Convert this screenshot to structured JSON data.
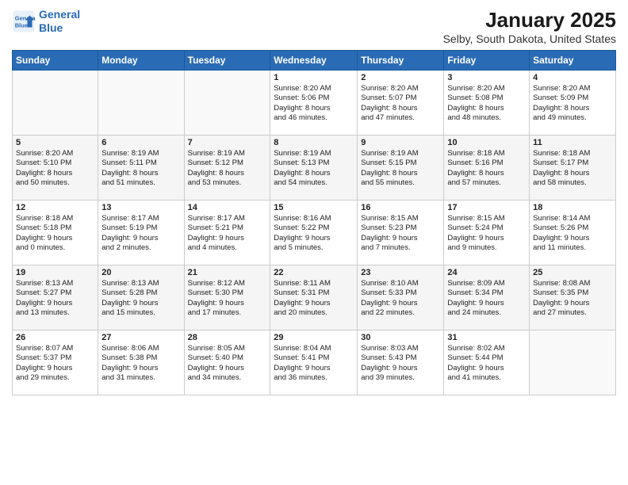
{
  "header": {
    "logo_line1": "General",
    "logo_line2": "Blue",
    "title": "January 2025",
    "subtitle": "Selby, South Dakota, United States"
  },
  "days_of_week": [
    "Sunday",
    "Monday",
    "Tuesday",
    "Wednesday",
    "Thursday",
    "Friday",
    "Saturday"
  ],
  "weeks": [
    [
      {
        "day": "",
        "info": ""
      },
      {
        "day": "",
        "info": ""
      },
      {
        "day": "",
        "info": ""
      },
      {
        "day": "1",
        "info": "Sunrise: 8:20 AM\nSunset: 5:06 PM\nDaylight: 8 hours\nand 46 minutes."
      },
      {
        "day": "2",
        "info": "Sunrise: 8:20 AM\nSunset: 5:07 PM\nDaylight: 8 hours\nand 47 minutes."
      },
      {
        "day": "3",
        "info": "Sunrise: 8:20 AM\nSunset: 5:08 PM\nDaylight: 8 hours\nand 48 minutes."
      },
      {
        "day": "4",
        "info": "Sunrise: 8:20 AM\nSunset: 5:09 PM\nDaylight: 8 hours\nand 49 minutes."
      }
    ],
    [
      {
        "day": "5",
        "info": "Sunrise: 8:20 AM\nSunset: 5:10 PM\nDaylight: 8 hours\nand 50 minutes."
      },
      {
        "day": "6",
        "info": "Sunrise: 8:19 AM\nSunset: 5:11 PM\nDaylight: 8 hours\nand 51 minutes."
      },
      {
        "day": "7",
        "info": "Sunrise: 8:19 AM\nSunset: 5:12 PM\nDaylight: 8 hours\nand 53 minutes."
      },
      {
        "day": "8",
        "info": "Sunrise: 8:19 AM\nSunset: 5:13 PM\nDaylight: 8 hours\nand 54 minutes."
      },
      {
        "day": "9",
        "info": "Sunrise: 8:19 AM\nSunset: 5:15 PM\nDaylight: 8 hours\nand 55 minutes."
      },
      {
        "day": "10",
        "info": "Sunrise: 8:18 AM\nSunset: 5:16 PM\nDaylight: 8 hours\nand 57 minutes."
      },
      {
        "day": "11",
        "info": "Sunrise: 8:18 AM\nSunset: 5:17 PM\nDaylight: 8 hours\nand 58 minutes."
      }
    ],
    [
      {
        "day": "12",
        "info": "Sunrise: 8:18 AM\nSunset: 5:18 PM\nDaylight: 9 hours\nand 0 minutes."
      },
      {
        "day": "13",
        "info": "Sunrise: 8:17 AM\nSunset: 5:19 PM\nDaylight: 9 hours\nand 2 minutes."
      },
      {
        "day": "14",
        "info": "Sunrise: 8:17 AM\nSunset: 5:21 PM\nDaylight: 9 hours\nand 4 minutes."
      },
      {
        "day": "15",
        "info": "Sunrise: 8:16 AM\nSunset: 5:22 PM\nDaylight: 9 hours\nand 5 minutes."
      },
      {
        "day": "16",
        "info": "Sunrise: 8:15 AM\nSunset: 5:23 PM\nDaylight: 9 hours\nand 7 minutes."
      },
      {
        "day": "17",
        "info": "Sunrise: 8:15 AM\nSunset: 5:24 PM\nDaylight: 9 hours\nand 9 minutes."
      },
      {
        "day": "18",
        "info": "Sunrise: 8:14 AM\nSunset: 5:26 PM\nDaylight: 9 hours\nand 11 minutes."
      }
    ],
    [
      {
        "day": "19",
        "info": "Sunrise: 8:13 AM\nSunset: 5:27 PM\nDaylight: 9 hours\nand 13 minutes."
      },
      {
        "day": "20",
        "info": "Sunrise: 8:13 AM\nSunset: 5:28 PM\nDaylight: 9 hours\nand 15 minutes."
      },
      {
        "day": "21",
        "info": "Sunrise: 8:12 AM\nSunset: 5:30 PM\nDaylight: 9 hours\nand 17 minutes."
      },
      {
        "day": "22",
        "info": "Sunrise: 8:11 AM\nSunset: 5:31 PM\nDaylight: 9 hours\nand 20 minutes."
      },
      {
        "day": "23",
        "info": "Sunrise: 8:10 AM\nSunset: 5:33 PM\nDaylight: 9 hours\nand 22 minutes."
      },
      {
        "day": "24",
        "info": "Sunrise: 8:09 AM\nSunset: 5:34 PM\nDaylight: 9 hours\nand 24 minutes."
      },
      {
        "day": "25",
        "info": "Sunrise: 8:08 AM\nSunset: 5:35 PM\nDaylight: 9 hours\nand 27 minutes."
      }
    ],
    [
      {
        "day": "26",
        "info": "Sunrise: 8:07 AM\nSunset: 5:37 PM\nDaylight: 9 hours\nand 29 minutes."
      },
      {
        "day": "27",
        "info": "Sunrise: 8:06 AM\nSunset: 5:38 PM\nDaylight: 9 hours\nand 31 minutes."
      },
      {
        "day": "28",
        "info": "Sunrise: 8:05 AM\nSunset: 5:40 PM\nDaylight: 9 hours\nand 34 minutes."
      },
      {
        "day": "29",
        "info": "Sunrise: 8:04 AM\nSunset: 5:41 PM\nDaylight: 9 hours\nand 36 minutes."
      },
      {
        "day": "30",
        "info": "Sunrise: 8:03 AM\nSunset: 5:43 PM\nDaylight: 9 hours\nand 39 minutes."
      },
      {
        "day": "31",
        "info": "Sunrise: 8:02 AM\nSunset: 5:44 PM\nDaylight: 9 hours\nand 41 minutes."
      },
      {
        "day": "",
        "info": ""
      }
    ]
  ]
}
